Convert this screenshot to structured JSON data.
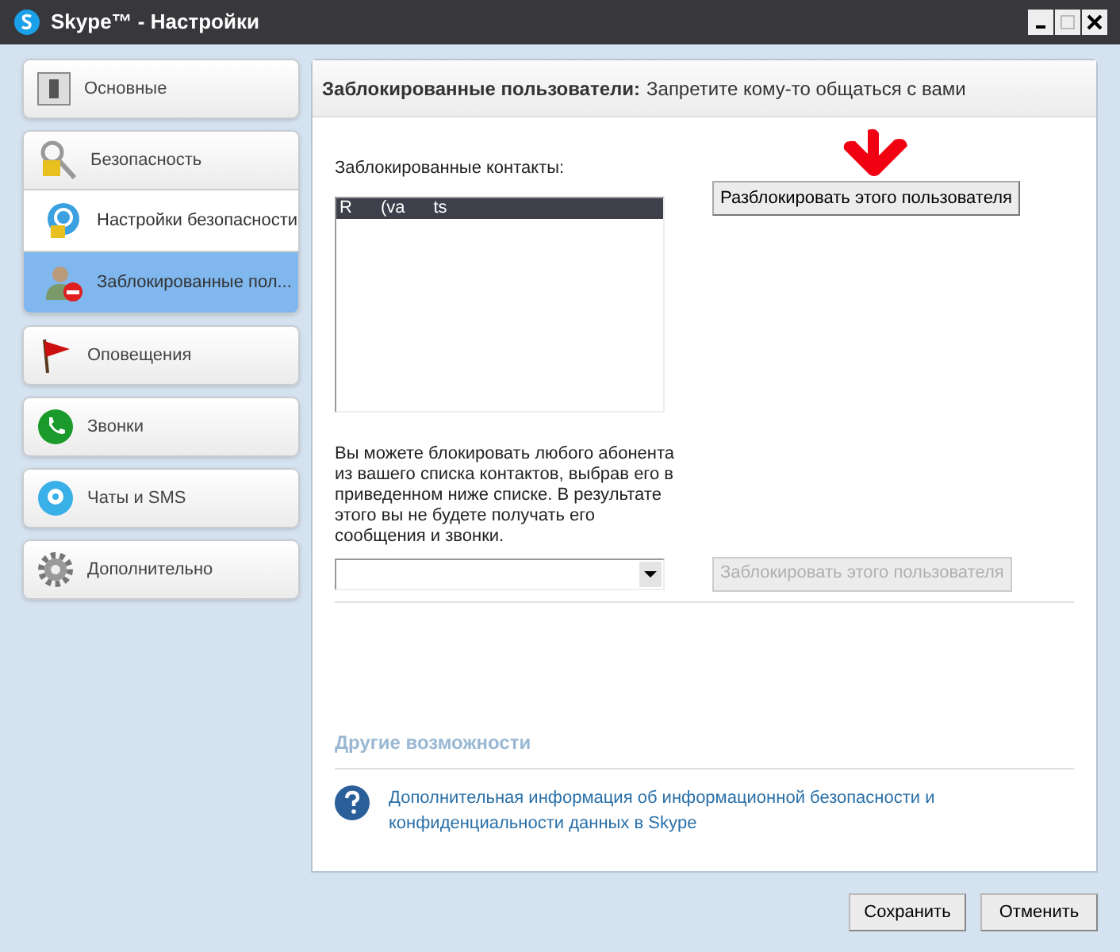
{
  "window": {
    "title": "Skype™ - Настройки"
  },
  "sidebar": {
    "items": [
      {
        "label": "Основные",
        "selected": false
      },
      {
        "label": "Безопасность",
        "selected": false,
        "children": [
          {
            "label": "Настройки безопасности",
            "selected": false
          },
          {
            "label": "Заблокированные пол...",
            "selected": true
          }
        ]
      },
      {
        "label": "Оповещения",
        "selected": false
      },
      {
        "label": "Звонки",
        "selected": false
      },
      {
        "label": "Чаты и SMS",
        "selected": false
      },
      {
        "label": "Дополнительно",
        "selected": false
      }
    ]
  },
  "header": {
    "title": "Заблокированные пользователи:",
    "subtitle": "Запретите кому-то общаться с вами"
  },
  "blocked": {
    "label": "Заблокированные контакты:",
    "contacts": [
      {
        "parts": [
          "R",
          "(va",
          "ts"
        ],
        "selected": true
      }
    ],
    "unblock_button": {
      "label": "Разблокировать этого пользователя",
      "disabled": false
    }
  },
  "block": {
    "description": "Вы можете блокировать любого абонента из вашего списка контактов, выбрав его в приведенном ниже списке. В результате этого вы не будете получать его сообщения и звонки.",
    "block_button": {
      "label": "Заблокировать этого пользователя",
      "disabled": true
    }
  },
  "other": {
    "title": "Другие возможности",
    "link": "Дополнительная информация об информационной безопасности и конфиденциальности данных в Skype"
  },
  "footer": {
    "buttons": [
      "Сохранить",
      "Отменить"
    ]
  }
}
